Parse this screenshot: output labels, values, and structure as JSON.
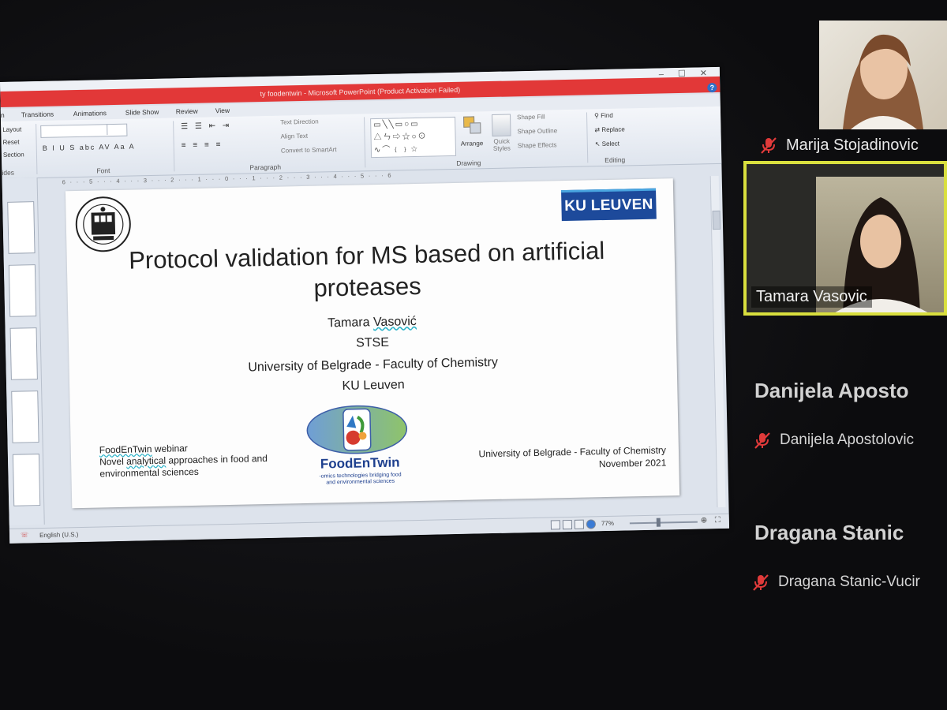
{
  "window": {
    "title": "ty foodentwin - Microsoft PowerPoint (Product Activation Failed)",
    "help_glyph": "?"
  },
  "ribbon_tabs": [
    "n",
    "Transitions",
    "Animations",
    "Slide Show",
    "Review",
    "View"
  ],
  "ribbon": {
    "layout": "Layout",
    "reset": "Reset",
    "section": "Section",
    "slides_group": "ides",
    "font_group": "Font",
    "paragraph_group": "Paragraph",
    "drawing_group": "Drawing",
    "editing_group": "Editing",
    "text_direction": "Text Direction",
    "align_text": "Align Text",
    "convert_smartart": "Convert to SmartArt",
    "arrange": "Arrange",
    "quick_styles": "Quick Styles",
    "shape_fill": "Shape Fill",
    "shape_outline": "Shape Outline",
    "shape_effects": "Shape Effects",
    "find": "Find",
    "replace": "Replace",
    "select": "Select",
    "font_buttons": "B I U S abc AV Aa A"
  },
  "ruler_text": "6 · · · 5 · · · 4 · · · 3 · · · 2 · · · 1 · · · 0 · · · 1 · · · 2 · · · 3 · · · 4 · · · 5 · · · 6",
  "statusbar": {
    "language": "English (U.S.)",
    "zoom": "77%"
  },
  "slide": {
    "logo_right": "KU LEUVEN",
    "title": "Protocol validation for MS based on artificial proteases",
    "author_first": "Tamara",
    "author_last": "Vasović",
    "line2": "STSE",
    "line3": "University of Belgrade - Faculty of Chemistry",
    "line4": "KU Leuven",
    "webinar_name": "FoodEnTwin",
    "webinar_suffix": " webinar",
    "webinar_line2_a": "Novel ",
    "webinar_line2_b": "analytical",
    "webinar_line2_c": " approaches in food and",
    "webinar_line3": "environmental sciences",
    "fet_name": "FoodEnTwin",
    "fet_tag1": "-omics technologies bridging food",
    "fet_tag2": "and environmental sciences",
    "footer_line1": "University of Belgrade - Faculty of Chemistry",
    "footer_line2": "November 2021"
  },
  "participants": {
    "marija": "Marija Stojadinovic",
    "tamara": "Tamara Vasovic",
    "danijela_big": "Danijela  Aposto",
    "danijela": "Danijela Apostolovic",
    "dragana_big": "Dragana  Stanic",
    "dragana": "Dragana Stanic-Vucir"
  },
  "colors": {
    "title_bar": "#e23838",
    "ku_blue": "#1d4a9b",
    "active_speaker_border": "#d9df3e",
    "mic_off": "#e03a3a"
  }
}
